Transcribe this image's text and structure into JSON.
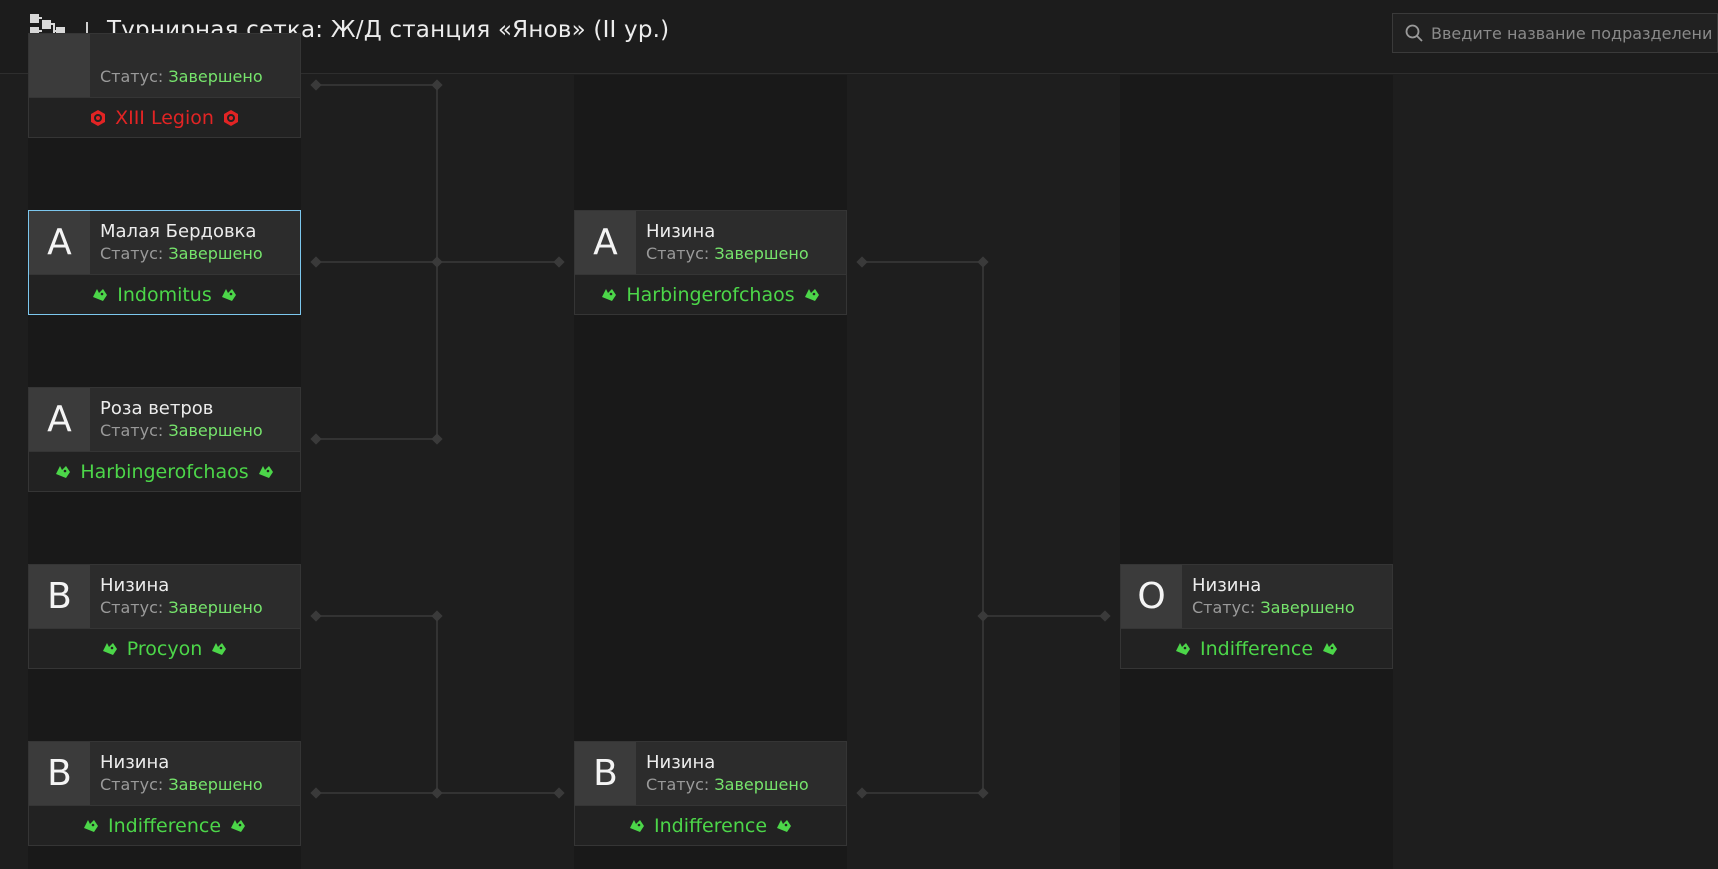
{
  "header": {
    "title": "Турнирная сетка: Ж/Д станция «Янов» (II ур.)",
    "logo_icon": "bracket-tree-icon"
  },
  "search": {
    "placeholder": "Введите название подразделения",
    "icon": "search-icon"
  },
  "status_label": "Статус:",
  "colors": {
    "green": "#4cd649",
    "status_green": "#76e46c",
    "red": "#e22424",
    "selected_border": "#7cc7ee"
  },
  "rounds": [
    {
      "matches": [
        {
          "badge": "",
          "location": "",
          "status": "Завершено",
          "team": "XIII Legion",
          "team_icon": "red-skull-emblem-icon"
        },
        {
          "badge": "A",
          "location": "Малая Бердовка",
          "status": "Завершено",
          "team": "Indomitus",
          "team_icon": "green-wolf-icon"
        },
        {
          "badge": "A",
          "location": "Роза ветров",
          "status": "Завершено",
          "team": "Harbingerofchaos",
          "team_icon": "green-wolf-icon"
        },
        {
          "badge": "B",
          "location": "Низина",
          "status": "Завершено",
          "team": "Procyon",
          "team_icon": "green-wolf-icon"
        },
        {
          "badge": "B",
          "location": "Низина",
          "status": "Завершено",
          "team": "Indifference",
          "team_icon": "green-wolf-icon"
        }
      ]
    },
    {
      "matches": [
        {
          "badge": "A",
          "location": "Низина",
          "status": "Завершено",
          "team": "Harbingerofchaos",
          "team_icon": "green-wolf-icon"
        },
        {
          "badge": "B",
          "location": "Низина",
          "status": "Завершено",
          "team": "Indifference",
          "team_icon": "green-wolf-icon"
        }
      ]
    },
    {
      "matches": [
        {
          "badge": "O",
          "location": "Низина",
          "status": "Завершено",
          "team": "Indifference",
          "team_icon": "green-wolf-icon"
        }
      ]
    }
  ]
}
